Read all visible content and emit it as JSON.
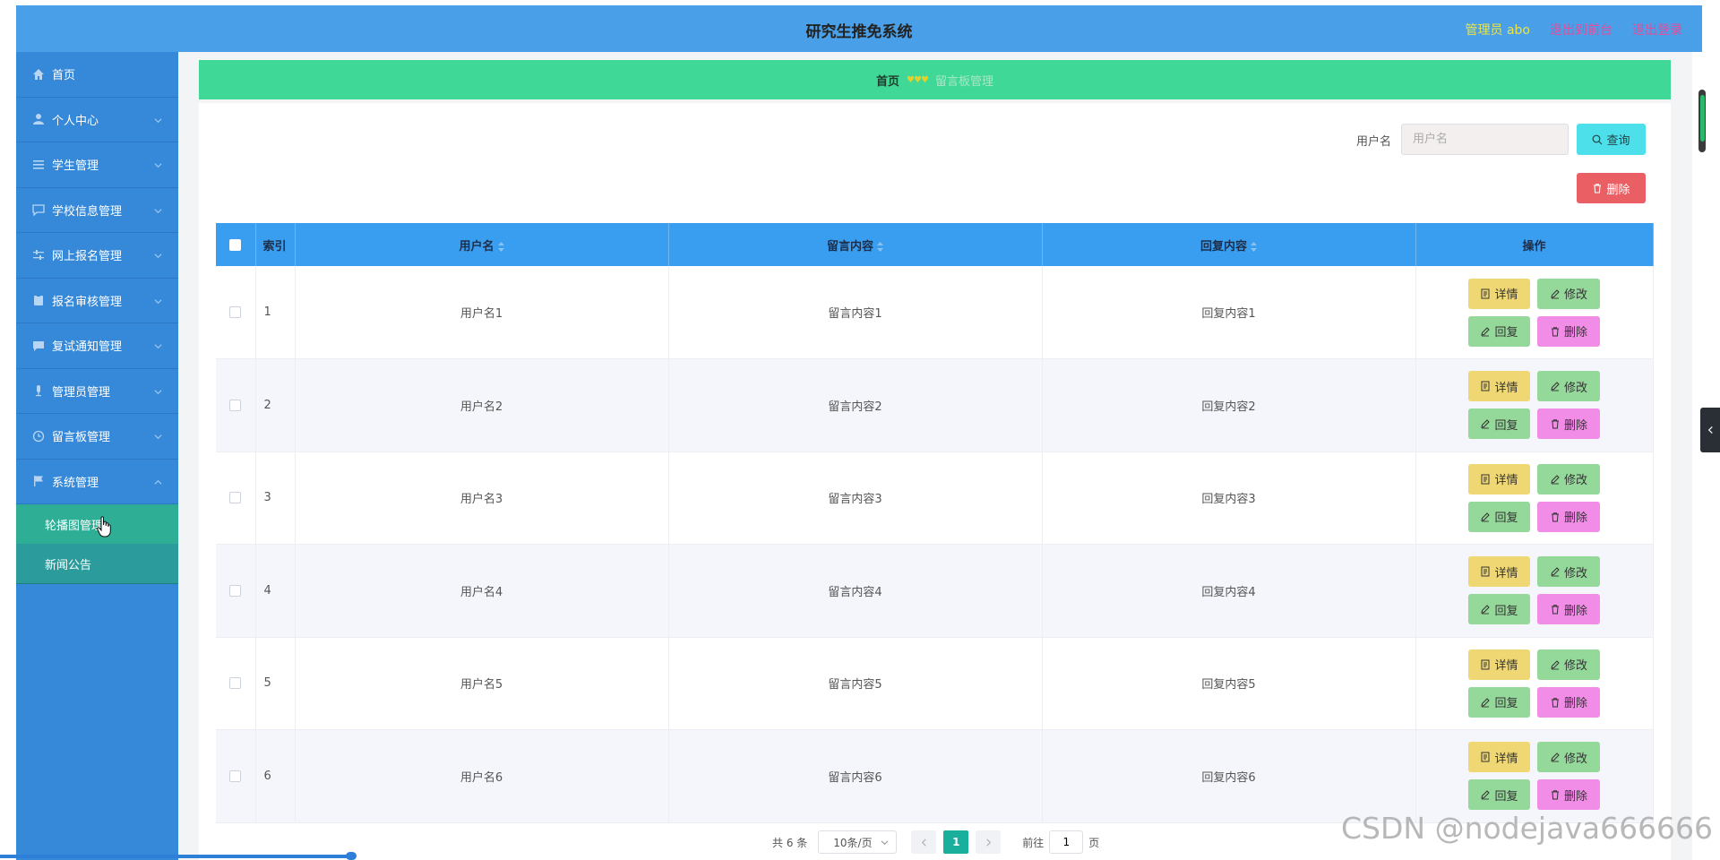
{
  "header": {
    "title": "研究生推免系统",
    "admin_label": "管理员 abo",
    "goto_front": "退出到前台",
    "logout": "退出登录"
  },
  "sidebar": {
    "items": [
      {
        "label": "首页",
        "icon": "home-icon",
        "chevron": false
      },
      {
        "label": "个人中心",
        "icon": "user-icon",
        "chevron": true
      },
      {
        "label": "学生管理",
        "icon": "list-icon",
        "chevron": true
      },
      {
        "label": "学校信息管理",
        "icon": "chat-icon",
        "chevron": true
      },
      {
        "label": "网上报名管理",
        "icon": "sliders-icon",
        "chevron": true
      },
      {
        "label": "报名审核管理",
        "icon": "clipboard-icon",
        "chevron": true
      },
      {
        "label": "复试通知管理",
        "icon": "message-icon",
        "chevron": true
      },
      {
        "label": "管理员管理",
        "icon": "mic-icon",
        "chevron": true
      },
      {
        "label": "留言板管理",
        "icon": "clock-icon",
        "chevron": true
      },
      {
        "label": "系统管理",
        "icon": "flag-icon",
        "chevron": true
      }
    ],
    "sub_items": [
      {
        "label": "轮播图管理",
        "active": true
      },
      {
        "label": "新闻公告",
        "active": false
      }
    ]
  },
  "breadcrumb": {
    "home": "首页",
    "separator": "♥♥♥",
    "current": "留言板管理"
  },
  "search": {
    "label": "用户名",
    "placeholder": "用户名",
    "query_label": "查询",
    "bulk_delete_label": "删除"
  },
  "table": {
    "columns": [
      "索引",
      "用户名",
      "留言内容",
      "回复内容",
      "操作"
    ],
    "rows": [
      {
        "index": "1",
        "username": "用户名1",
        "message": "留言内容1",
        "reply": "回复内容1"
      },
      {
        "index": "2",
        "username": "用户名2",
        "message": "留言内容2",
        "reply": "回复内容2"
      },
      {
        "index": "3",
        "username": "用户名3",
        "message": "留言内容3",
        "reply": "回复内容3"
      },
      {
        "index": "4",
        "username": "用户名4",
        "message": "留言内容4",
        "reply": "回复内容4"
      },
      {
        "index": "5",
        "username": "用户名5",
        "message": "留言内容5",
        "reply": "回复内容5"
      },
      {
        "index": "6",
        "username": "用户名6",
        "message": "留言内容6",
        "reply": "回复内容6"
      }
    ],
    "actions": {
      "detail": "详情",
      "edit": "修改",
      "reply": "回复",
      "delete": "删除"
    }
  },
  "pagination": {
    "total": "共 6 条",
    "page_size": "10条/页",
    "current_page": "1",
    "goto_label": "前往",
    "goto_value": "1",
    "page_suffix": "页"
  },
  "watermark": "CSDN @nodejava666666",
  "colors": {
    "header_bg": "#4aa0e8",
    "sidebar_bg": "#3688d8",
    "breadcrumb_bg": "#3fd896",
    "table_head_bg": "#3a9ef0",
    "accent_teal": "#1aaf9c"
  }
}
